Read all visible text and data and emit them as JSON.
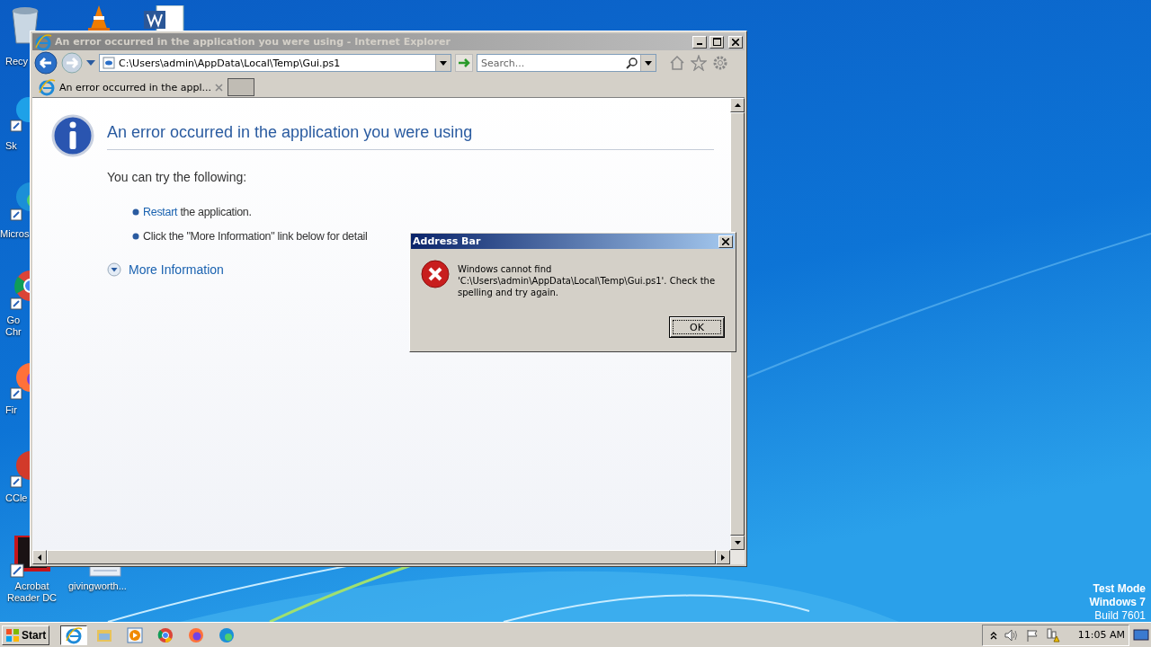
{
  "desktop": {
    "icons": [
      {
        "kind": "recycle-bin",
        "lines": [
          "Recy"
        ]
      },
      {
        "kind": "cone"
      },
      {
        "kind": "word-doc"
      },
      {
        "kind": "skype",
        "lines": [
          "Sk"
        ]
      },
      {
        "kind": "edge",
        "lines": [
          "Micros"
        ]
      },
      {
        "kind": "chrome",
        "lines": [
          "Go",
          "Chr"
        ]
      },
      {
        "kind": "firefox",
        "lines": [
          "Fir"
        ]
      },
      {
        "kind": "ccleaner",
        "lines": [
          "CCle"
        ]
      },
      {
        "kind": "acrobat",
        "lines": [
          "Acrobat",
          "Reader DC"
        ]
      },
      {
        "kind": "document",
        "lines": [
          "givingworth..."
        ]
      }
    ],
    "edition": [
      "Test Mode",
      "Windows 7",
      "Build 7601"
    ]
  },
  "browser": {
    "title": "An error occurred in the application you were using - Internet Explorer",
    "active": false,
    "address": "C:\\Users\\admin\\AppData\\Local\\Temp\\Gui.ps1",
    "search": {
      "placeholder": "Search..."
    },
    "tabs": [
      {
        "label": "An error occurred in the appl...",
        "selected": true
      }
    ],
    "page": {
      "heading": "An error occurred in the application you were using",
      "intro": "You can try the following:",
      "bullets": [
        {
          "link": "Restart",
          "text": " the application."
        },
        {
          "text": "Click the \"More Information\" link below for detail"
        }
      ],
      "more": {
        "label": "More Information",
        "expanded": false
      }
    }
  },
  "dialog": {
    "title": "Address Bar",
    "message": "Windows cannot find 'C:\\Users\\admin\\AppData\\Local\\Temp\\Gui.ps1'. Check the spelling and try again.",
    "buttons": [
      {
        "label": "OK",
        "focused": true
      }
    ]
  },
  "taskbar": {
    "start": "Start",
    "items": [
      {
        "kind": "ie",
        "selected": true
      },
      {
        "kind": "folder",
        "selected": false
      },
      {
        "kind": "media",
        "selected": false
      },
      {
        "kind": "chrome",
        "selected": false
      },
      {
        "kind": "firefox",
        "selected": false
      },
      {
        "kind": "edge",
        "selected": false
      }
    ],
    "clock": "11:05 AM"
  }
}
